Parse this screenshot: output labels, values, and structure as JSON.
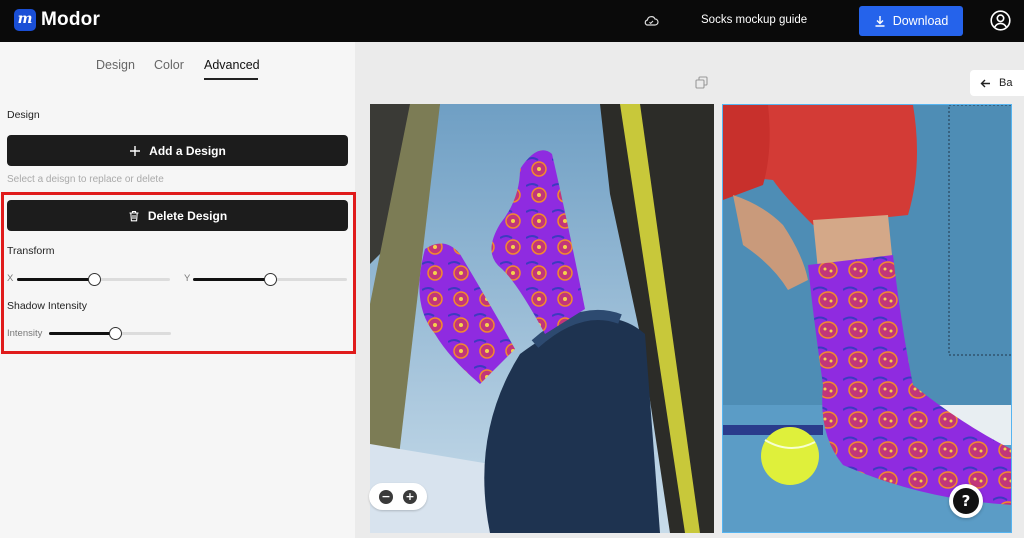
{
  "app": {
    "logo_letter": "m",
    "name": "Modor",
    "brand_color": "#1a4fd6"
  },
  "header": {
    "cloud_icon": "cloud-sync-icon",
    "guide_link": "Socks mockup guide",
    "download_label": "Download",
    "download_color": "#2563eb",
    "account_icon": "account-circle-icon"
  },
  "sidebar": {
    "tabs": [
      {
        "label": "Design",
        "active": false
      },
      {
        "label": "Color",
        "active": false
      },
      {
        "label": "Advanced",
        "active": true
      }
    ],
    "design_section_label": "Design",
    "add_design_label": "Add a Design",
    "hint": "Select a deisgn to replace or delete",
    "delete_design_label": "Delete Design",
    "highlight_color": "#e01b1b",
    "transform": {
      "label": "Transform",
      "x_label": "X",
      "x_value": 0.5,
      "y_label": "Y",
      "y_value": 0.5
    },
    "shadow": {
      "label": "Shadow Intensity",
      "intensity_label": "Intensity",
      "intensity_value": 0.54
    }
  },
  "canvas": {
    "copy_icon": "copy-icon",
    "back_label": "Ba",
    "zoom_out_label": "−",
    "zoom_in_label": "+",
    "help_label": "?",
    "preview_images": [
      {
        "name": "sock-mockup-car-window",
        "selected": false
      },
      {
        "name": "sock-mockup-tennis",
        "selected": true
      }
    ]
  }
}
